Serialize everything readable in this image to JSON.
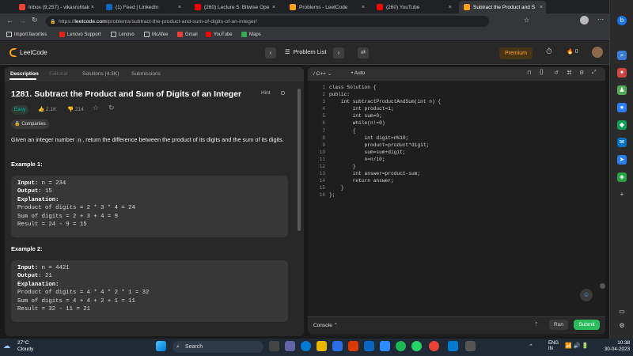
{
  "browser": {
    "tabs": [
      {
        "label": "Inbox (9,257) - vikasrohtak",
        "color": "#ea4335"
      },
      {
        "label": "(1) Feed | LinkedIn",
        "color": "#0a66c2"
      },
      {
        "label": "(260) Lecture 5: Bitwise Ope",
        "color": "#ff0000"
      },
      {
        "label": "Problems - LeetCode",
        "color": "#ffa116"
      },
      {
        "label": "(260) YouTube",
        "color": "#ff0000"
      },
      {
        "label": "Subtract the Product and S",
        "color": "#ffa116"
      }
    ],
    "url_prefix": "https://",
    "url_host": "leetcode.com",
    "url_path": "/problems/subtract-the-product-and-sum-of-digits-of-an-integer/",
    "favorites": [
      "Import favorites",
      "Lenovo Support",
      "Lenovo",
      "McAfee",
      "Gmail",
      "YouTube",
      "Maps"
    ]
  },
  "leetcode": {
    "logo": "LeetCode",
    "problem_list": "Problem List",
    "premium": "Premium",
    "coins": "0"
  },
  "problem": {
    "tabs": [
      "Description",
      "Editorial",
      "Solutions (4.3K)",
      "Submissions"
    ],
    "title": "1281. Subtract the Product and Sum of Digits of an Integer",
    "hint": "Hint",
    "difficulty": "Easy",
    "likes": "2.1K",
    "dislikes": "214",
    "companies": "Companies",
    "desc_before": "Given an integer number ",
    "desc_code": "n",
    "desc_after": ", return the difference between the product of its digits and the sum of its digits.",
    "ex1_title": "Example 1:",
    "ex1": {
      "input_label": "Input:",
      "input": " n = 234",
      "output_label": "Output:",
      "output": " 15",
      "expl_label": "Explanation:",
      "l1": "Product of digits = 2 * 3 * 4 = 24",
      "l2": "Sum of digits = 2 + 3 + 4 = 9",
      "l3": "Result = 24 - 9 = 15"
    },
    "ex2_title": "Example 2:",
    "ex2": {
      "input_label": "Input:",
      "input": " n = 4421",
      "output_label": "Output:",
      "output": " 21",
      "expl_label": "Explanation:",
      "l1": "Product of digits = 4 * 4 * 2 * 1 = 32",
      "l2": "Sum of digits = 4 + 4 + 2 + 1 = 11",
      "l3": "Result = 32 - 11 = 21"
    }
  },
  "editor": {
    "language": "C++",
    "mode": "Auto",
    "lines": [
      "class Solution {",
      "public:",
      "    int subtractProductAndSum(int n) {",
      "        int product=1;",
      "        int sum=0;",
      "        while(n!=0)",
      "        {",
      "            int digit=n%10;",
      "            product=product*digit;",
      "            sum=sum+digit;",
      "            n=n/10;",
      "        }",
      "        int answer=product-sum;",
      "        return answer;",
      "    }",
      "};"
    ],
    "console": "Console",
    "run": "Run",
    "submit": "Submit"
  },
  "taskbar": {
    "temp": "27°C",
    "weather": "Cloudy",
    "search": "Search",
    "lang1": "ENG",
    "lang2": "IN",
    "time": "10:38",
    "date": "30-04-2023"
  }
}
